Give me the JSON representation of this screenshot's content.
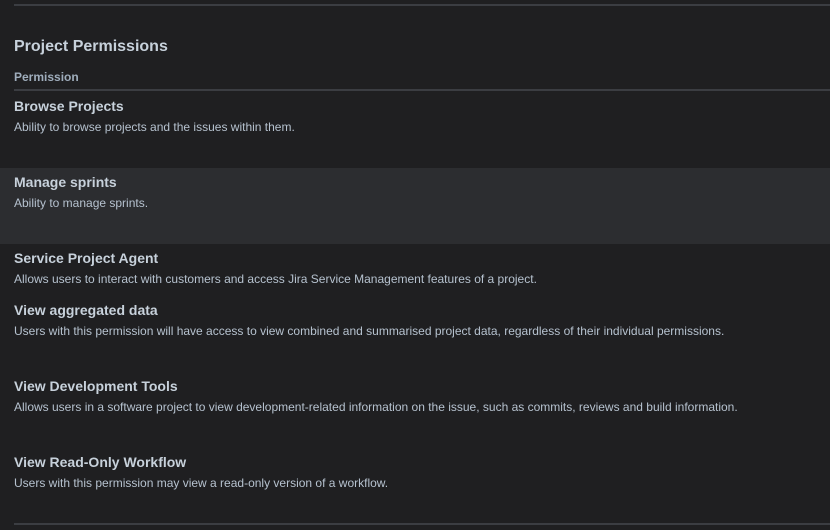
{
  "section": {
    "title": "Project Permissions",
    "column_header": "Permission"
  },
  "permissions": [
    {
      "name": "Browse Projects",
      "description": "Ability to browse projects and the issues within them."
    },
    {
      "name": "Manage sprints",
      "description": "Ability to manage sprints."
    },
    {
      "name": "Service Project Agent",
      "description": "Allows users to interact with customers and access Jira Service Management features of a project."
    },
    {
      "name": "View aggregated data",
      "description": "Users with this permission will have access to view combined and summarised project data, regardless of their individual permissions."
    },
    {
      "name": "View Development Tools",
      "description": "Allows users in a software project to view development-related information on the issue, such as commits, reviews and build information."
    },
    {
      "name": "View Read-Only Workflow",
      "description": "Users with this permission may view a read-only version of a workflow."
    }
  ]
}
